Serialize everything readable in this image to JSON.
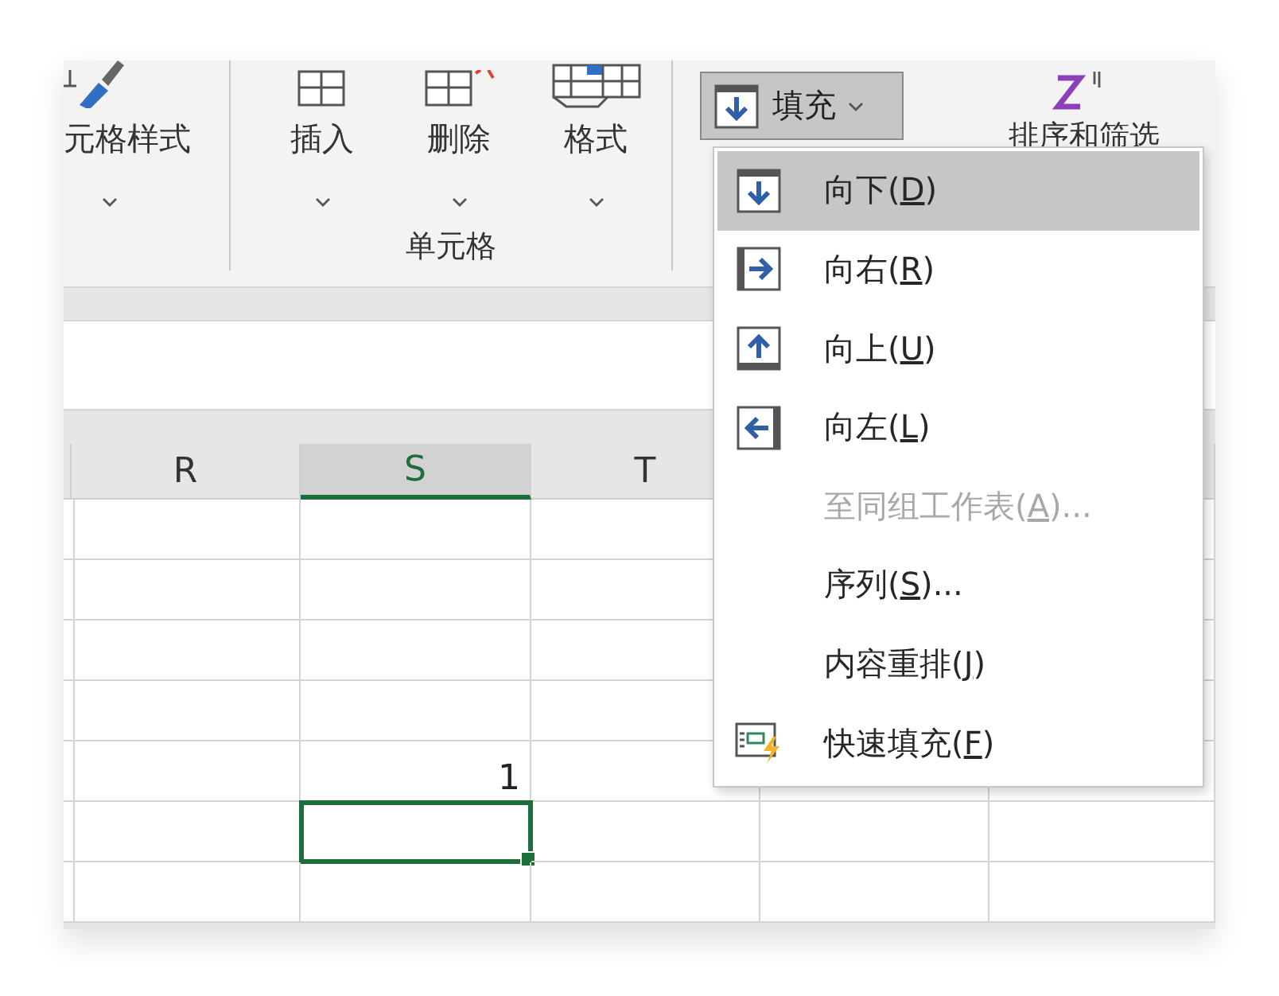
{
  "ribbon": {
    "style_button": {
      "label": "元格样式"
    },
    "cells_group": {
      "label": "单元格",
      "buttons": [
        {
          "label": "插入"
        },
        {
          "label": "删除"
        },
        {
          "label": "格式"
        }
      ]
    },
    "fill_button": {
      "label": "填充",
      "expanded": true
    },
    "sort_button": {
      "label": "排序和筛选"
    }
  },
  "fill_menu": [
    {
      "before": "向下(",
      "key": "D",
      "after": ")",
      "selected": true,
      "disabled": false
    },
    {
      "before": "向右(",
      "key": "R",
      "after": ")",
      "selected": false,
      "disabled": false
    },
    {
      "before": "向上(",
      "key": "U",
      "after": ")",
      "selected": false,
      "disabled": false
    },
    {
      "before": "向左(",
      "key": "L",
      "after": ")",
      "selected": false,
      "disabled": false
    },
    {
      "before": "至同组工作表(",
      "key": "A",
      "after": ")...",
      "selected": false,
      "disabled": true
    },
    {
      "before": "序列(",
      "key": "S",
      "after": ")...",
      "selected": false,
      "disabled": false
    },
    {
      "before": "内容重排(",
      "key": "J",
      "after": ")",
      "selected": false,
      "disabled": false
    },
    {
      "before": "快速填充(",
      "key": "F",
      "after": ")",
      "selected": false,
      "disabled": false
    }
  ],
  "sheet": {
    "columns": [
      {
        "label": "R",
        "selected": false
      },
      {
        "label": "S",
        "selected": true
      },
      {
        "label": "T",
        "selected": false
      }
    ],
    "rows": [
      {
        "cells": [
          {
            "selected": false
          },
          {
            "selected": false
          },
          {
            "selected": false
          },
          {},
          {
            "selected": false
          }
        ]
      },
      {
        "cells": [
          {
            "selected": false
          },
          {
            "selected": false
          },
          {
            "selected": false
          },
          {},
          {
            "selected": false
          }
        ]
      },
      {
        "cells": [
          {
            "selected": false
          },
          {
            "selected": false
          },
          {
            "selected": false
          },
          {},
          {
            "selected": false
          }
        ]
      },
      {
        "cells": [
          {
            "selected": false
          },
          {
            "selected": false
          },
          {
            "selected": false
          },
          {},
          {
            "selected": false
          }
        ]
      },
      {
        "cells": [
          {
            "selected": false
          },
          {
            "selected": false,
            "value": "1"
          },
          {
            "selected": false
          },
          {
            "selected": false
          },
          {
            "selected": false
          }
        ]
      },
      {
        "cells": [
          {
            "selected": false
          },
          {
            "selected": true
          },
          {
            "selected": false
          },
          {
            "selected": false
          },
          {
            "selected": false
          }
        ]
      },
      {
        "cells": [
          {
            "selected": false
          },
          {
            "selected": false
          },
          {
            "selected": false
          },
          {
            "selected": false
          },
          {
            "selected": false
          }
        ]
      }
    ]
  }
}
